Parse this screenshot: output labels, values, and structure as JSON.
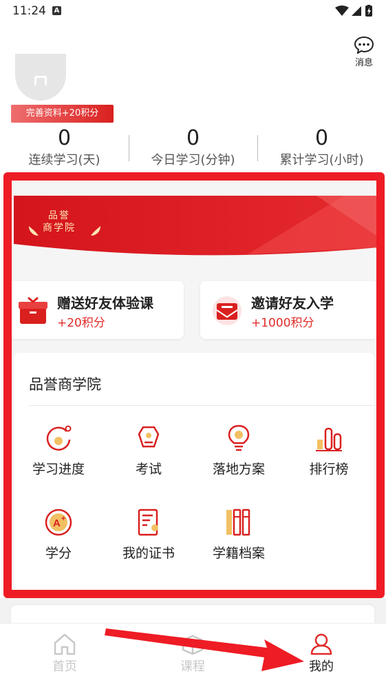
{
  "status_bar": {
    "time": "11:24",
    "notification_badge": "A"
  },
  "header": {
    "messages_label": "消息"
  },
  "profile": {
    "complete_profile_badge": "完善资料+20积分"
  },
  "stats": [
    {
      "value": "0",
      "label": "连续学习(天)"
    },
    {
      "value": "0",
      "label": "今日学习(分钟)"
    },
    {
      "value": "0",
      "label": "累计学习(小时)"
    }
  ],
  "banner": {
    "brand_line1": "品誉",
    "brand_line2": "商学院"
  },
  "invites": [
    {
      "title": "赠送好友体验课",
      "points": "+20积分",
      "icon": "gift-box-icon"
    },
    {
      "title": "邀请好友入学",
      "points": "+1000积分",
      "icon": "invite-envelope-icon"
    }
  ],
  "section": {
    "title": "品誉商学院",
    "items": [
      {
        "label": "学习进度",
        "icon": "progress-icon"
      },
      {
        "label": "考试",
        "icon": "exam-icon"
      },
      {
        "label": "落地方案",
        "icon": "bulb-icon"
      },
      {
        "label": "排行榜",
        "icon": "ranking-icon"
      },
      {
        "label": "学分",
        "icon": "credit-icon"
      },
      {
        "label": "我的证书",
        "icon": "certificate-icon"
      },
      {
        "label": "学籍档案",
        "icon": "archive-icon"
      }
    ]
  },
  "tabbar": {
    "tabs": [
      {
        "label": "首页",
        "icon": "home-icon",
        "active": false
      },
      {
        "label": "课程",
        "icon": "course-icon",
        "active": false
      },
      {
        "label": "我的",
        "icon": "profile-icon",
        "active": true
      }
    ]
  },
  "colors": {
    "accent": "#ee1c24",
    "brand_red": "#d9201f",
    "points_red": "#e02c2a",
    "inactive_tab": "#c8c8c8"
  }
}
